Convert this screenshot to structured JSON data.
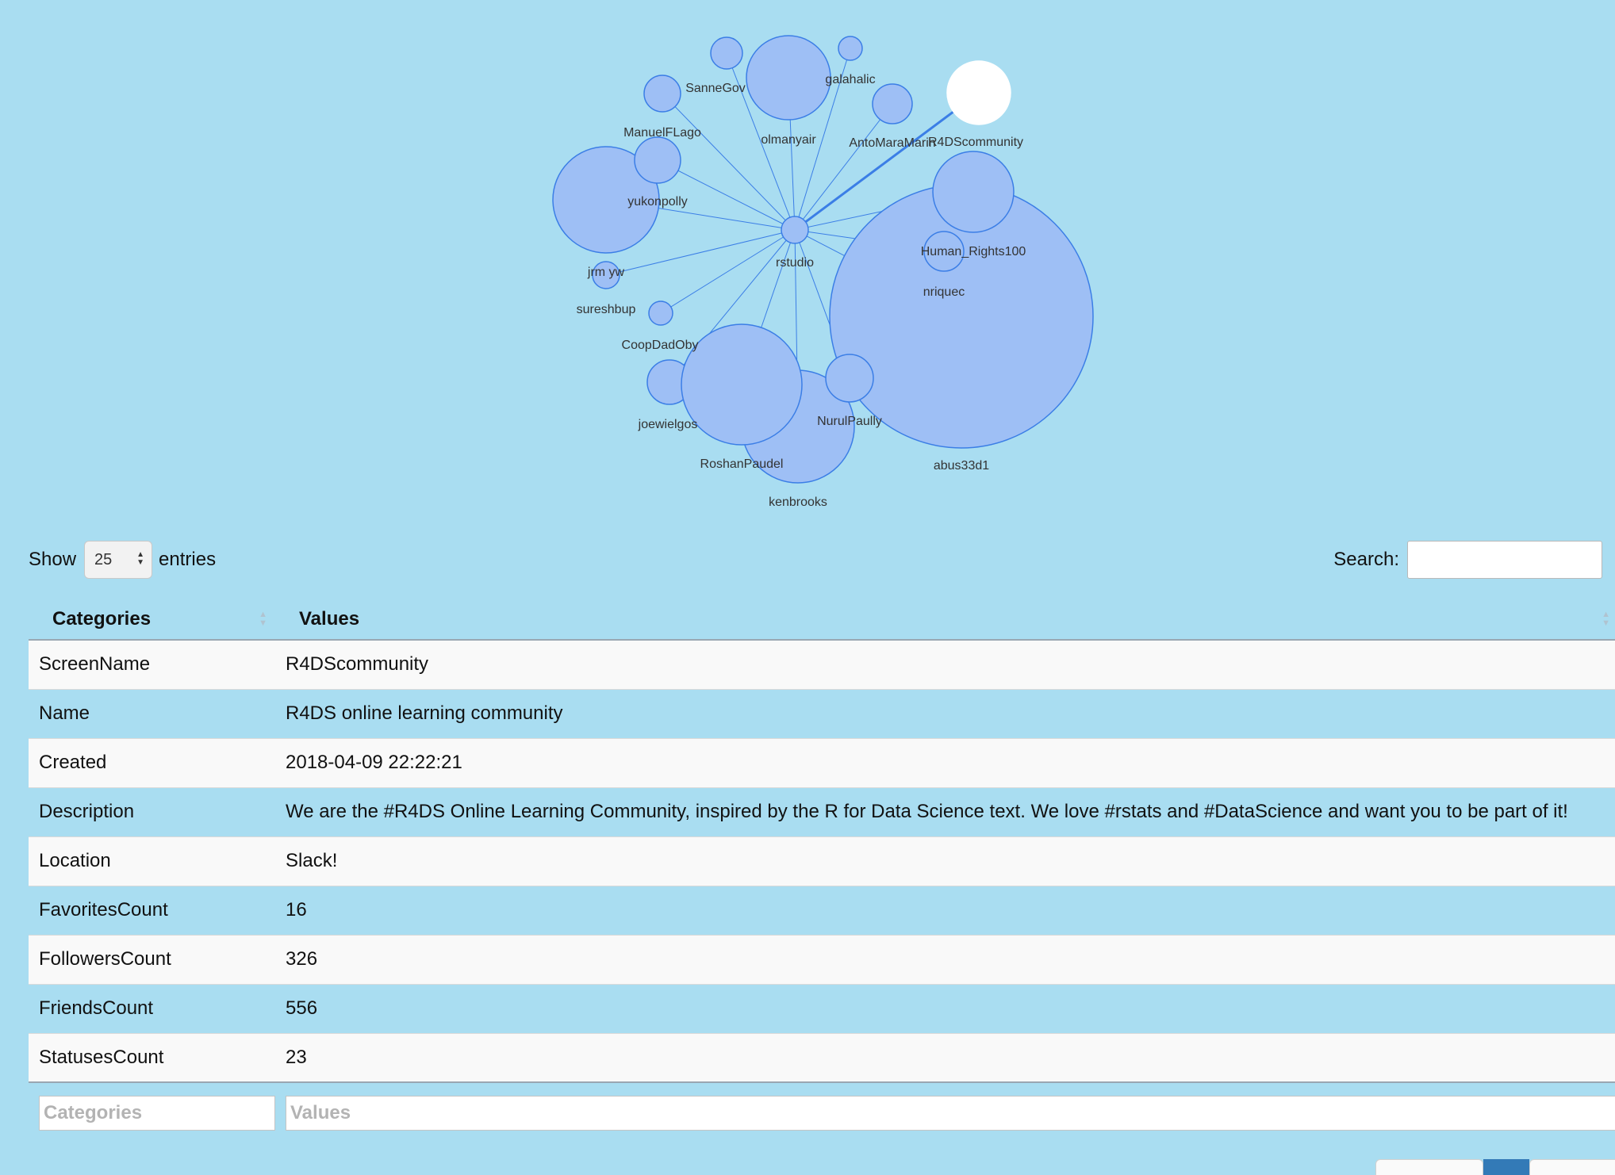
{
  "graph": {
    "center": "rstudio",
    "selected": "R4DScommunity",
    "colors": {
      "node": "#9ebff5",
      "stroke": "#3b7ee6",
      "selected": "#ffffff",
      "background": "#a9ddf1"
    },
    "labels": {
      "sannegov": "SanneGov",
      "galahalic": "galahalic",
      "olmanyair": "olmanyair",
      "manuelflago": "ManuelFLago",
      "antomaramarin": "AntoMaraMarin",
      "r4dscommunity": "R4DScommunity",
      "yukonpolly": "yukonpolly",
      "rstudio": "rstudio",
      "human_rights100": "Human_Rights100",
      "nriquec": "nriquec",
      "jrm": "jrm      yw",
      "sureshbup": "sureshbup",
      "coopdadoby": "CoopDadOby",
      "joewielgos": "joewielgos",
      "nurulpaully": "NurulPaully",
      "roshanpaudel": "RoshanPaudel",
      "abus33d1": "abus33d1",
      "kenbrooks": "kenbrooks"
    }
  },
  "controls": {
    "show_label": "Show",
    "entries_value": "25",
    "entries_label": "entries",
    "search_label": "Search:"
  },
  "table": {
    "headers": {
      "categories": "Categories",
      "values": "Values"
    },
    "rows": [
      {
        "category": "ScreenName",
        "value": "R4DScommunity"
      },
      {
        "category": "Name",
        "value": "R4DS online learning community"
      },
      {
        "category": "Created",
        "value": "2018-04-09 22:22:21"
      },
      {
        "category": "Description",
        "value": "We are the #R4DS Online Learning Community, inspired by the R for Data Science text. We love #rstats and #DataScience and want you to be part of it!"
      },
      {
        "category": "Location",
        "value": "Slack!"
      },
      {
        "category": "FavoritesCount",
        "value": "16"
      },
      {
        "category": "FollowersCount",
        "value": "326"
      },
      {
        "category": "FriendsCount",
        "value": "556"
      },
      {
        "category": "StatusesCount",
        "value": "23"
      }
    ],
    "filters": {
      "categories_placeholder": "Categories",
      "values_placeholder": "Values"
    }
  }
}
